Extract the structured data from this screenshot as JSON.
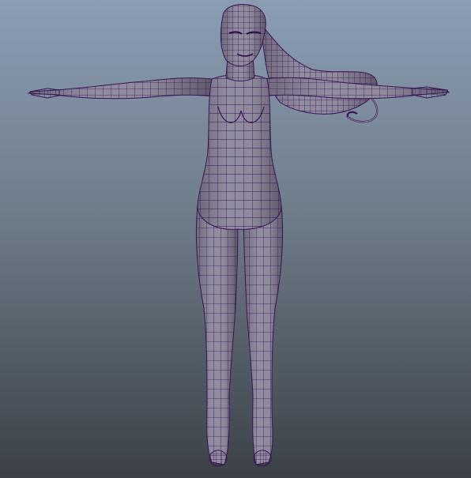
{
  "viewport": {
    "background_top": "#8a9db3",
    "background_mid": "#6f7c8a",
    "background_bottom": "#3b4147",
    "mesh_fill": "#8f8a9c",
    "mesh_shade": "#6d6879",
    "wire_color": "#3a1458",
    "model": "t-pose-female-wireframe-mesh"
  }
}
